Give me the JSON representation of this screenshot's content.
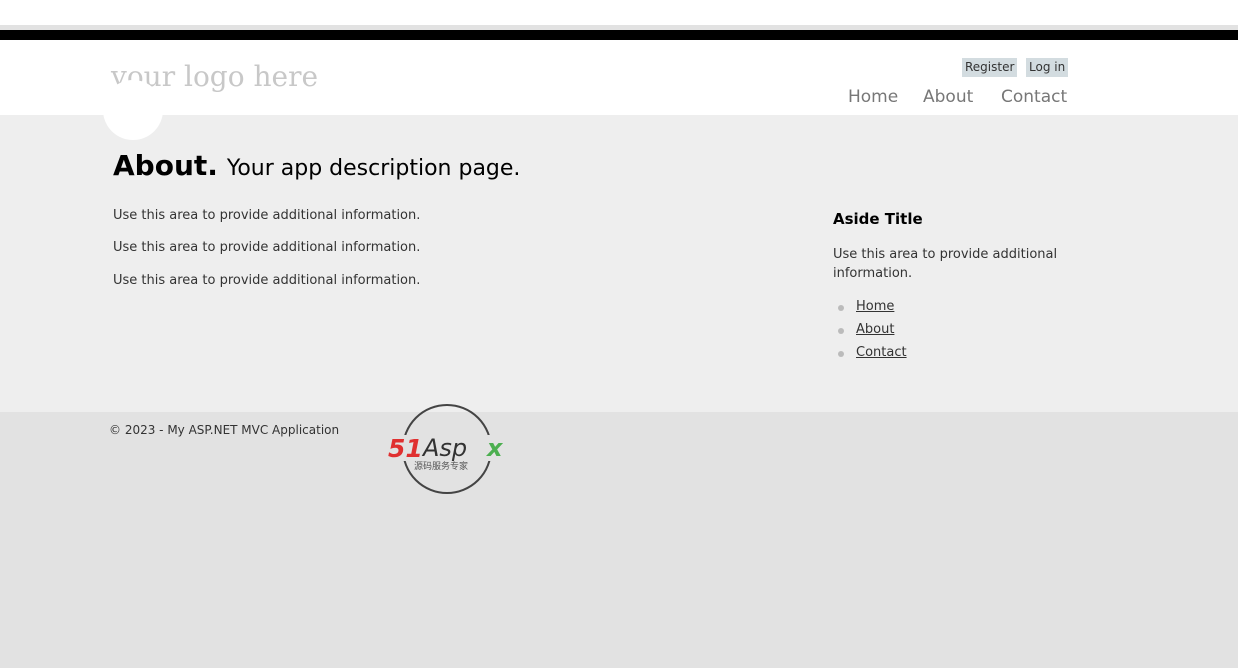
{
  "header": {
    "logo_text": "your logo here",
    "login": {
      "register": "Register",
      "login": "Log in"
    },
    "nav": [
      "Home",
      "About",
      "Contact"
    ]
  },
  "main": {
    "title_bold": "About.",
    "title_rest": "Your app description page.",
    "paragraphs": [
      "Use this area to provide additional information.",
      "Use this area to provide additional information.",
      "Use this area to provide additional information."
    ]
  },
  "aside": {
    "title": "Aside Title",
    "text": "Use this area to provide additional information.",
    "links": [
      "Home",
      "About",
      "Contact"
    ]
  },
  "footer": {
    "copyright": "© 2023 - My ASP.NET MVC Application",
    "watermark": {
      "brand": "51Aspx",
      "tagline": "源码服务专家"
    }
  }
}
